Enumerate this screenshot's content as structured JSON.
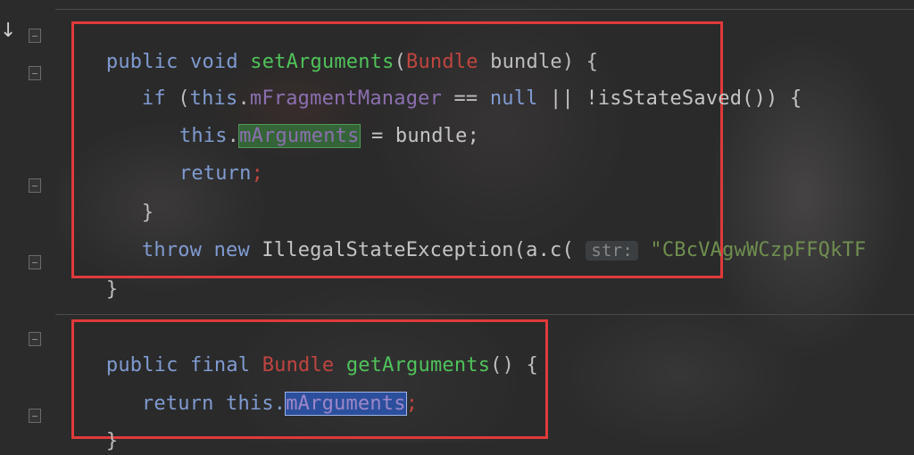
{
  "editor": {
    "method_set": {
      "line1": {
        "kw1": "public",
        "kw2": "void",
        "name": "setArguments",
        "open": "(",
        "type": "Bundle",
        "param": " bundle) {"
      },
      "line2": {
        "kw_if": "if",
        "paren": " (",
        "this": "this",
        "dot": ".",
        "field": "mFragmentManager",
        "op": " == ",
        "null": "null",
        "rest": " || !isStateSaved()) {"
      },
      "line3": {
        "this": "this",
        "dot": ".",
        "field": "mArguments",
        "rest": " = bundle;"
      },
      "line4": {
        "kw": "return",
        "semi": ";"
      },
      "line5": {
        "brace": "}"
      },
      "line6": {
        "kw1": "throw",
        "kw2": "new",
        "call": " IllegalStateException(a.c(",
        "hint": "str:",
        "string": "\"CBcVAgwWCzpFFQkTF"
      },
      "line7": {
        "brace": "}"
      }
    },
    "method_get": {
      "line1": {
        "kw1": "public",
        "kw2": "final",
        "type": "Bundle",
        "name": "getArguments",
        "rest": "() {"
      },
      "line2": {
        "kw": "return",
        "this": " this.",
        "field": "mArguments",
        "semi": ";"
      },
      "line3": {
        "brace": "}"
      }
    }
  },
  "colors": {
    "highlight_box": "#e03a3a",
    "keyword": "#7f9bd1",
    "method": "#4fc35a",
    "type": "#c0453f"
  },
  "icons": [
    "down-arrow-icon",
    "fold-marker-icon"
  ]
}
